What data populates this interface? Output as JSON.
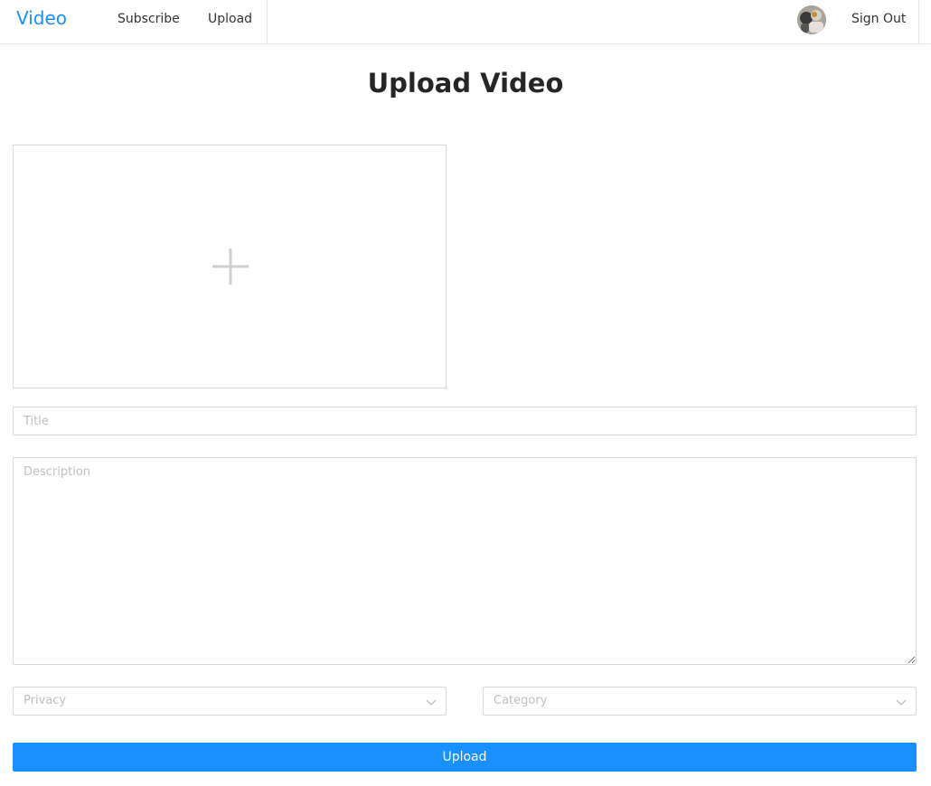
{
  "navbar": {
    "logo": "Video",
    "links": [
      {
        "label": "Subscribe"
      },
      {
        "label": "Upload"
      }
    ],
    "signout_label": "Sign Out",
    "accent_color": "#1890ff"
  },
  "page": {
    "title": "Upload Video"
  },
  "form": {
    "dropzone_icon": "plus-icon",
    "title_placeholder": "Title",
    "title_value": "",
    "description_placeholder": "Description",
    "description_value": "",
    "privacy_placeholder": "Privacy",
    "category_placeholder": "Category",
    "submit_label": "Upload",
    "submit_color": "#1890ff"
  }
}
